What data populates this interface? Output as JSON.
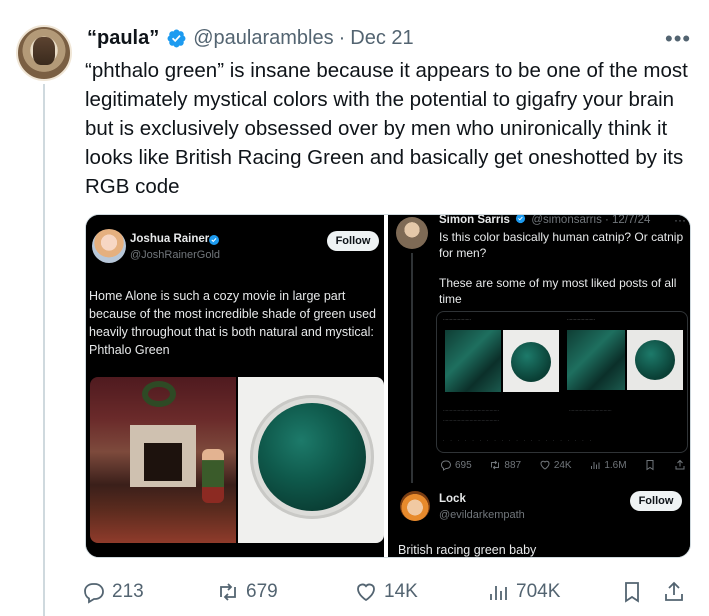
{
  "tweet": {
    "display_name": "“paula”",
    "handle": "@paularambles",
    "separator": "·",
    "date": "Dec 21",
    "more_label": "•••",
    "text": "“phthalo green” is insane because it appears to be one of the most legitimately mystical colors with the potential to gigafry your brain but is exclusively obsessed over by men who unironically think it looks like British Racing Green and basically get oneshotted by its RGB code",
    "stats": {
      "replies": "213",
      "reposts": "679",
      "likes": "14K",
      "views": "704K"
    }
  },
  "media": {
    "left": {
      "name": "Joshua Rainer",
      "handle": "@JoshRainerGold",
      "follow_label": "Follow",
      "text": "Home Alone is such a cozy movie in large part because of the most incredible shade of green used heavily throughout that is both natural and mystical: Phthalo Green"
    },
    "right": {
      "name": "Simon Sarris",
      "handle": "@simonsarris · 12/7/24",
      "more_label": "···",
      "text": "Is this color basically human catnip? Or catnip for men?",
      "text2": "These are some of my most liked posts of all time",
      "stats": {
        "replies": "695",
        "reposts": "887",
        "likes": "24K",
        "views": "1.6M"
      },
      "reply_name": "Lock",
      "reply_handle": "@evildarkempath",
      "reply_follow_label": "Follow",
      "reply_text": "British racing green baby"
    }
  },
  "colors": {
    "accent": "#1d9bf0",
    "text": "#0f1419",
    "muted": "#536471",
    "phthalo": "#0a3f35"
  }
}
